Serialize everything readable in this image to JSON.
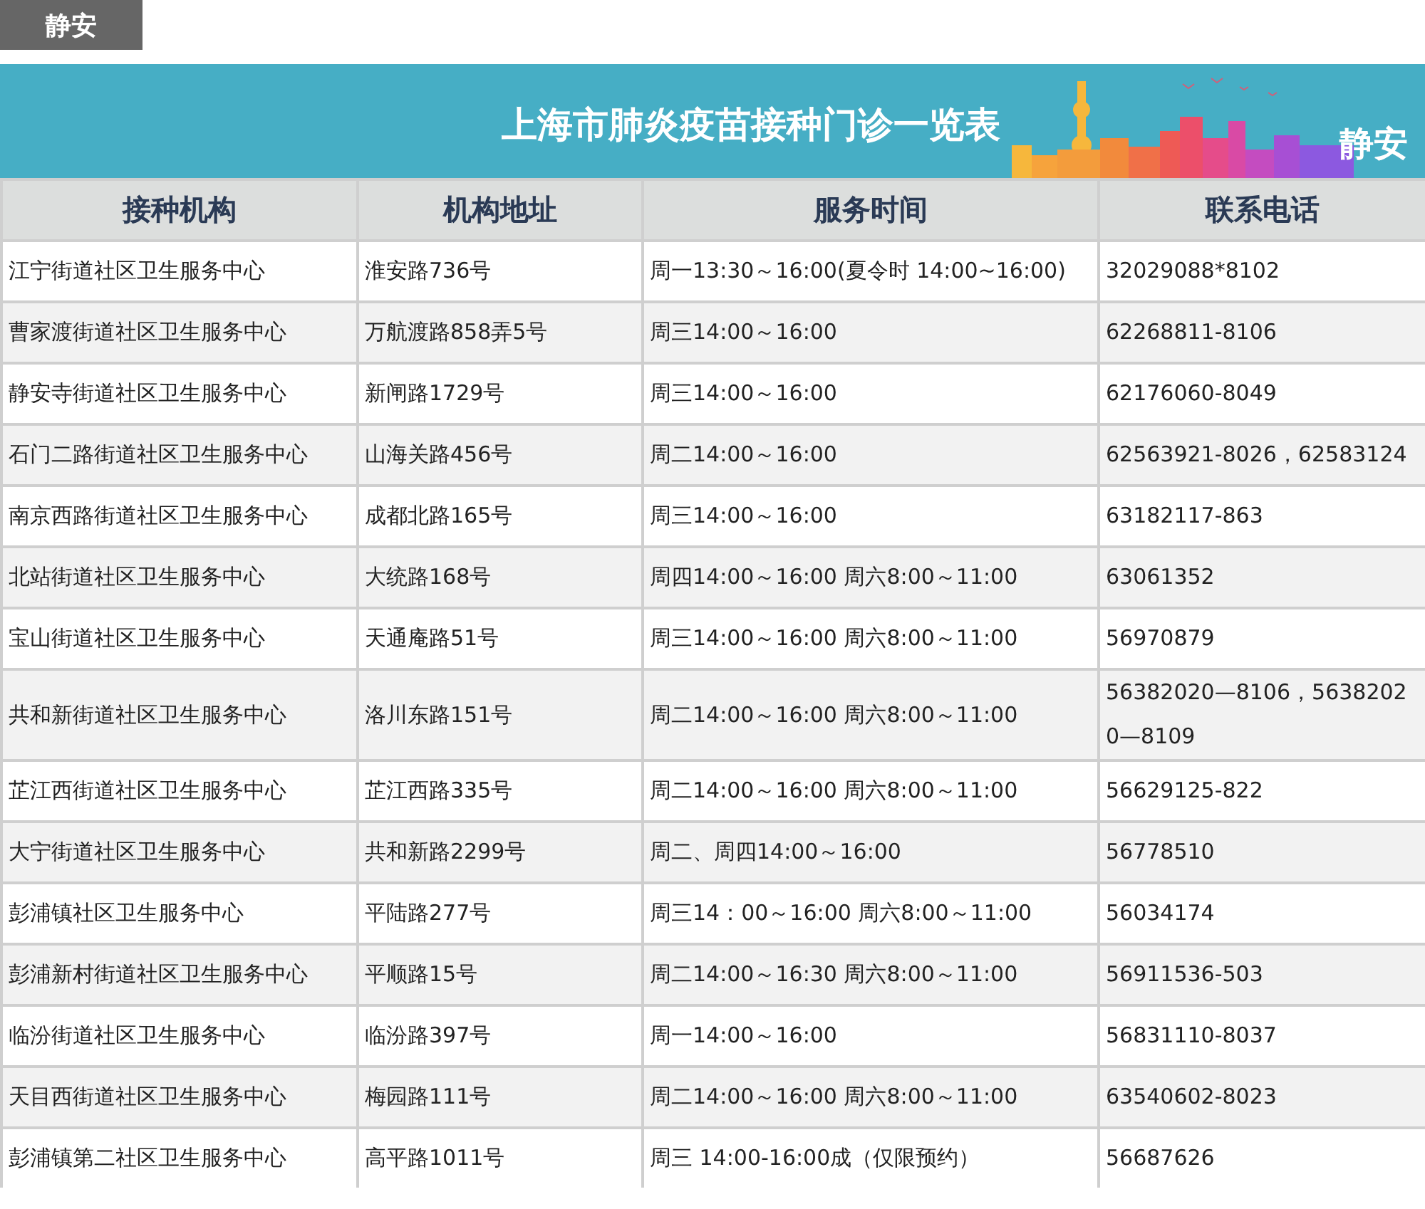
{
  "district_tag": "静安",
  "banner": {
    "title": "上海市肺炎疫苗接种门诊一览表",
    "district": "静安"
  },
  "table": {
    "columns": [
      "接种机构",
      "机构地址",
      "服务时间",
      "联系电话"
    ],
    "rows": [
      [
        "江宁街道社区卫生服务中心",
        "淮安路736号",
        "周一13:30～16:00(夏令时 14:00~16:00)",
        "32029088*8102"
      ],
      [
        "曹家渡街道社区卫生服务中心",
        "万航渡路858弄5号",
        "周三14:00～16:00",
        "62268811-8106"
      ],
      [
        "静安寺街道社区卫生服务中心",
        "新闸路1729号",
        "周三14:00～16:00",
        "62176060-8049"
      ],
      [
        "石门二路街道社区卫生服务中心",
        "山海关路456号",
        "周二14:00～16:00",
        "62563921-8026，62583124"
      ],
      [
        "南京西路街道社区卫生服务中心",
        "成都北路165号",
        "周三14:00～16:00",
        "63182117-863"
      ],
      [
        "北站街道社区卫生服务中心",
        "大统路168号",
        "周四14:00～16:00 周六8:00～11:00",
        "63061352"
      ],
      [
        "宝山街道社区卫生服务中心",
        "天通庵路51号",
        "周三14:00～16:00 周六8:00～11:00",
        "56970879"
      ],
      [
        "共和新街道社区卫生服务中心",
        "洛川东路151号",
        "周二14:00～16:00 周六8:00～11:00",
        "56382020—8106，56382020—8109"
      ],
      [
        "芷江西街道社区卫生服务中心",
        "芷江西路335号",
        "周二14:00～16:00 周六8:00～11:00",
        "56629125-822"
      ],
      [
        "大宁街道社区卫生服务中心",
        "共和新路2299号",
        "周二、周四14:00～16:00",
        "56778510"
      ],
      [
        "彭浦镇社区卫生服务中心",
        "平陆路277号",
        "周三14：00～16:00 周六8:00～11:00",
        "56034174"
      ],
      [
        "彭浦新村街道社区卫生服务中心",
        "平顺路15号",
        "周二14:00～16:30 周六8:00～11:00",
        "56911536-503"
      ],
      [
        "临汾街道社区卫生服务中心",
        "临汾路397号",
        "周一14:00～16:00",
        "56831110-8037"
      ],
      [
        "天目西街道社区卫生服务中心",
        "梅园路111号",
        "周二14:00～16:00 周六8:00～11:00",
        "63540602-8023"
      ],
      [
        "彭浦镇第二社区卫生服务中心",
        "高平路1011号",
        "周三 14:00-16:00成（仅限预约）",
        "56687626"
      ]
    ]
  }
}
